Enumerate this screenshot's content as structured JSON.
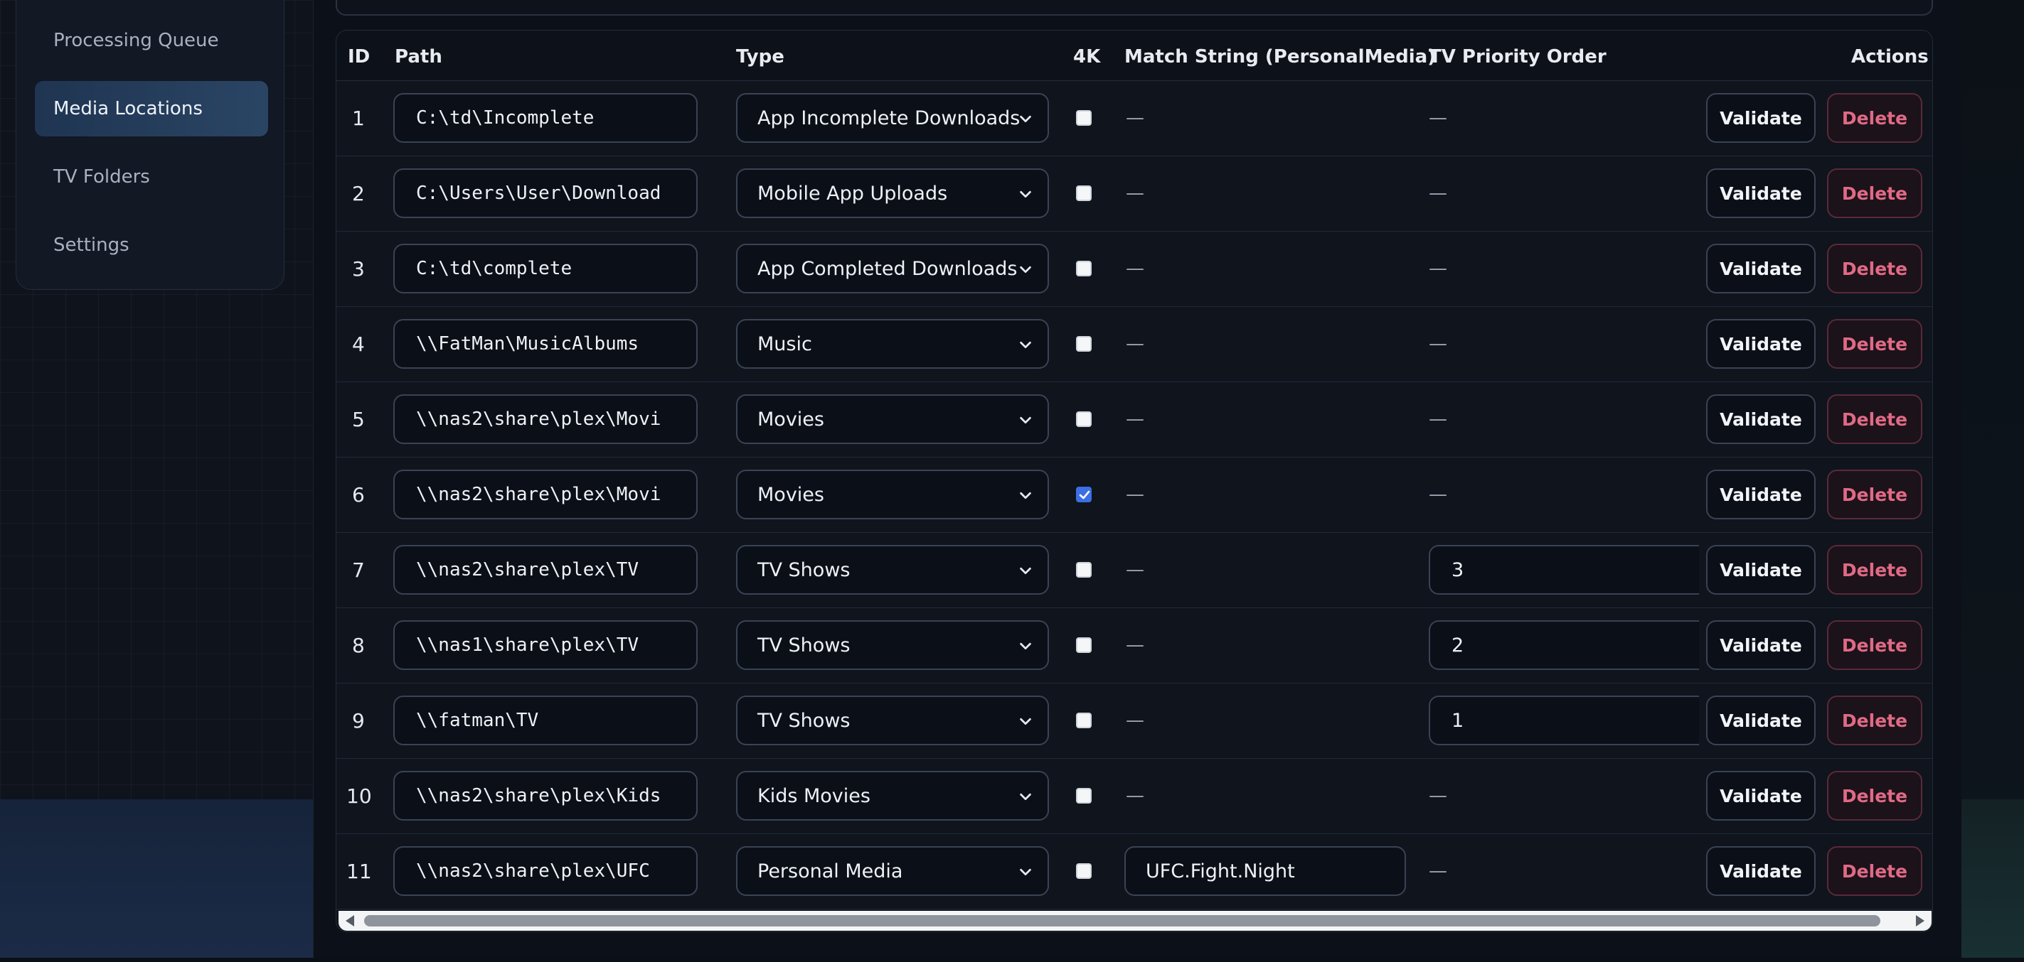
{
  "sidebar": {
    "items": [
      {
        "label": "Processing Queue",
        "active": false
      },
      {
        "label": "Media Locations",
        "active": true
      },
      {
        "label": "TV Folders",
        "active": false
      },
      {
        "label": "Settings",
        "active": false
      }
    ]
  },
  "table": {
    "headers": {
      "id": "ID",
      "path": "Path",
      "type": "Type",
      "fourk": "4K",
      "match": "Match String (PersonalMedia)",
      "priority": "TV Priority Order",
      "actions": "Actions"
    },
    "dash": "—",
    "validate_label": "Validate",
    "delete_label": "Delete",
    "rows": [
      {
        "id": "1",
        "path": "C:\\td\\Incomplete",
        "type": "App Incomplete Downloads",
        "fourk": false,
        "match": "",
        "priority": ""
      },
      {
        "id": "2",
        "path": "C:\\Users\\User\\Download",
        "type": "Mobile App Uploads",
        "fourk": false,
        "match": "",
        "priority": ""
      },
      {
        "id": "3",
        "path": "C:\\td\\complete",
        "type": "App Completed Downloads",
        "fourk": false,
        "match": "",
        "priority": ""
      },
      {
        "id": "4",
        "path": "\\\\FatMan\\MusicAlbums",
        "type": "Music",
        "fourk": false,
        "match": "",
        "priority": ""
      },
      {
        "id": "5",
        "path": "\\\\nas2\\share\\plex\\Movi",
        "type": "Movies",
        "fourk": false,
        "match": "",
        "priority": ""
      },
      {
        "id": "6",
        "path": "\\\\nas2\\share\\plex\\Movi",
        "type": "Movies",
        "fourk": true,
        "match": "",
        "priority": ""
      },
      {
        "id": "7",
        "path": "\\\\nas2\\share\\plex\\TV",
        "type": "TV Shows",
        "fourk": false,
        "match": "",
        "priority": "3"
      },
      {
        "id": "8",
        "path": "\\\\nas1\\share\\plex\\TV",
        "type": "TV Shows",
        "fourk": false,
        "match": "",
        "priority": "2"
      },
      {
        "id": "9",
        "path": "\\\\fatman\\TV",
        "type": "TV Shows",
        "fourk": false,
        "match": "",
        "priority": "1"
      },
      {
        "id": "10",
        "path": "\\\\nas2\\share\\plex\\Kids",
        "type": "Kids Movies",
        "fourk": false,
        "match": "",
        "priority": ""
      },
      {
        "id": "11",
        "path": "\\\\nas2\\share\\plex\\UFC",
        "type": "Personal Media",
        "fourk": false,
        "match": "UFC.Fight.Night",
        "priority": ""
      }
    ]
  },
  "colors": {
    "accent_checked": "#3b6fe3",
    "delete_text": "#e06a86",
    "active_nav": "#2a4564"
  },
  "icons": {
    "select_chevron": "chevron-down-icon",
    "checkbox_check": "check-icon"
  }
}
